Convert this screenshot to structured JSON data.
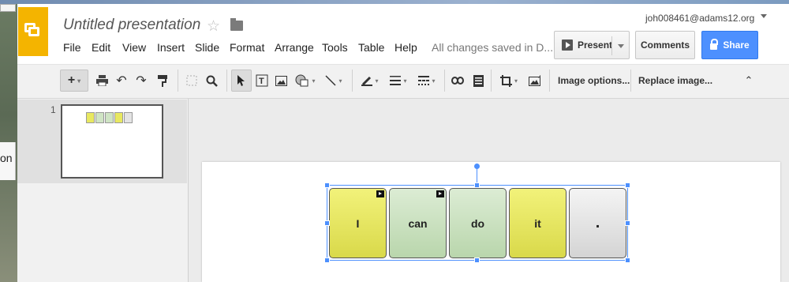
{
  "document": {
    "title": "Untitled presentation",
    "status": "All changes saved in D...",
    "user": "joh008461@adams12.org"
  },
  "menu": [
    "File",
    "Edit",
    "View",
    "Insert",
    "Slide",
    "Format",
    "Arrange",
    "Tools",
    "Table",
    "Help"
  ],
  "actions": {
    "present_label": "Present",
    "comments_label": "Comments",
    "share_label": "Share"
  },
  "toolbar": {
    "image_options_label": "Image options...",
    "replace_image_label": "Replace image..."
  },
  "filmstrip": {
    "slide_number": "1"
  },
  "external": {
    "partial_text": "on"
  },
  "slide": {
    "cards": [
      {
        "text": "I",
        "color": "#e8e860",
        "has_sound_icon": true
      },
      {
        "text": "can",
        "color": "#cfe4c4",
        "has_sound_icon": true
      },
      {
        "text": "do",
        "color": "#cfe4c4",
        "has_sound_icon": false
      },
      {
        "text": "it",
        "color": "#e8e860",
        "has_sound_icon": false
      },
      {
        "text": ".",
        "color": "#e4e4e4",
        "has_sound_icon": false
      }
    ]
  },
  "colors": {
    "app_accent": "#f4b400",
    "share_button": "#4d90fe",
    "selection": "#4d90fe"
  }
}
